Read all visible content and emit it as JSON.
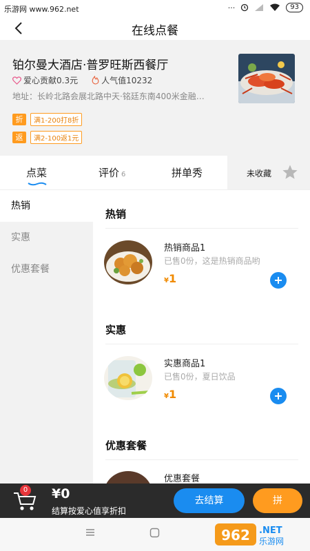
{
  "status_bar": {
    "carrier": "乐游网 www.962.net",
    "battery": "93"
  },
  "navbar": {
    "title": "在线点餐"
  },
  "hotel": {
    "name": "铂尔曼大酒店·普罗旺斯西餐厅",
    "love": "爱心贡献0.3元",
    "popularity": "人气值10232",
    "address": "地址：长岭北路会展北路中天·铭廷东南400米金融…",
    "promos": [
      {
        "tag": "折",
        "desc": "满1-200打8折"
      },
      {
        "tag": "返",
        "desc": "满2-100返1元"
      }
    ]
  },
  "tabs": {
    "order": "点菜",
    "review": "评价",
    "review_count": "6",
    "group_show": "拼单秀",
    "favorite": "未收藏"
  },
  "sidebar": {
    "items": [
      "热销",
      "实惠",
      "优惠套餐"
    ]
  },
  "sections": [
    {
      "title": "热销",
      "products": [
        {
          "name": "热销商品1",
          "sub": "已售0份，这是热销商品哟",
          "currency": "¥",
          "price": "1"
        }
      ]
    },
    {
      "title": "实惠",
      "products": [
        {
          "name": "实惠商品1",
          "sub": "已售0份，夏日饮品",
          "currency": "¥",
          "price": "1"
        }
      ]
    },
    {
      "title": "优惠套餐",
      "products": [
        {
          "name": "优惠套餐"
        }
      ]
    }
  ],
  "cart": {
    "badge": "0",
    "total": "¥0",
    "hint": "结算按爱心值享折扣",
    "checkout": "去结算",
    "pin": "拼"
  },
  "watermark": {
    "brand": "962",
    "sub": "乐游网",
    "suffix": ".NET"
  },
  "colors": {
    "accent_blue": "#1a8cf0",
    "accent_orange": "#ff9b1f",
    "cart_bar": "#2b2b2b",
    "badge_red": "#e7353a"
  },
  "icons": [
    "back-arrow-icon",
    "heart-icon",
    "flame-icon",
    "star-icon",
    "plus-icon",
    "cart-icon",
    "wifi-icon",
    "signal-icon"
  ]
}
